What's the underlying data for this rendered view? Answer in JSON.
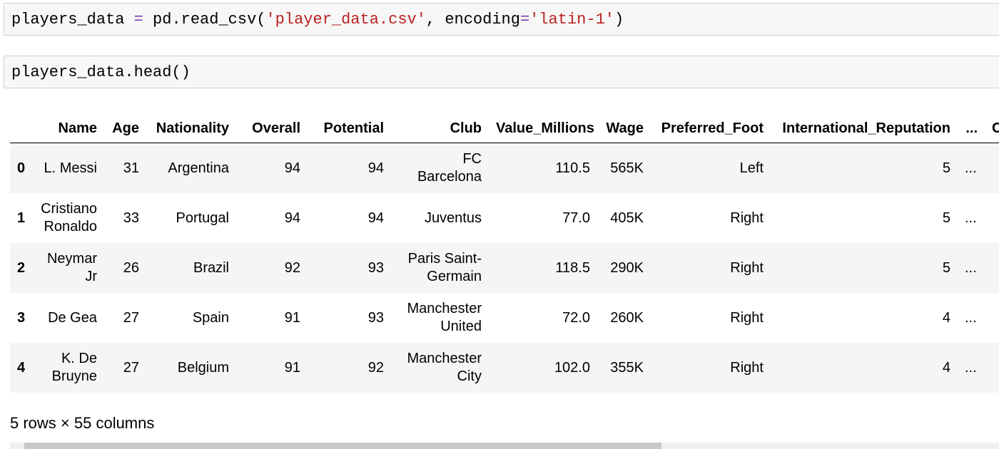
{
  "cells": {
    "read_csv": {
      "var": "players_data",
      "op": " = ",
      "func": "pd.read_csv(",
      "arg1": "'player_data.csv'",
      "comma": ", encoding",
      "eq": "=",
      "arg2": "'latin-1'",
      "close": ")"
    },
    "head": {
      "code": "players_data.head()"
    }
  },
  "table": {
    "columns": [
      "Name",
      "Age",
      "Nationality",
      "Overall",
      "Potential",
      "Club",
      "Value_Millions",
      "Wage",
      "Preferred_Foot",
      "International_Reputation",
      "...",
      "Co"
    ],
    "rows": [
      {
        "index": "0",
        "cells": [
          "L. Messi",
          "31",
          "Argentina",
          "94",
          "94",
          "FC Barcelona",
          "110.5",
          "565K",
          "Left",
          "5",
          "..."
        ]
      },
      {
        "index": "1",
        "cells": [
          "Cristiano Ronaldo",
          "33",
          "Portugal",
          "94",
          "94",
          "Juventus",
          "77.0",
          "405K",
          "Right",
          "5",
          "..."
        ]
      },
      {
        "index": "2",
        "cells": [
          "Neymar Jr",
          "26",
          "Brazil",
          "92",
          "93",
          "Paris Saint-Germain",
          "118.5",
          "290K",
          "Right",
          "5",
          "..."
        ]
      },
      {
        "index": "3",
        "cells": [
          "De Gea",
          "27",
          "Spain",
          "91",
          "93",
          "Manchester United",
          "72.0",
          "260K",
          "Right",
          "4",
          "..."
        ]
      },
      {
        "index": "4",
        "cells": [
          "K. De Bruyne",
          "27",
          "Belgium",
          "91",
          "92",
          "Manchester City",
          "102.0",
          "355K",
          "Right",
          "4",
          "..."
        ]
      }
    ]
  },
  "summary": "5 rows × 55 columns"
}
